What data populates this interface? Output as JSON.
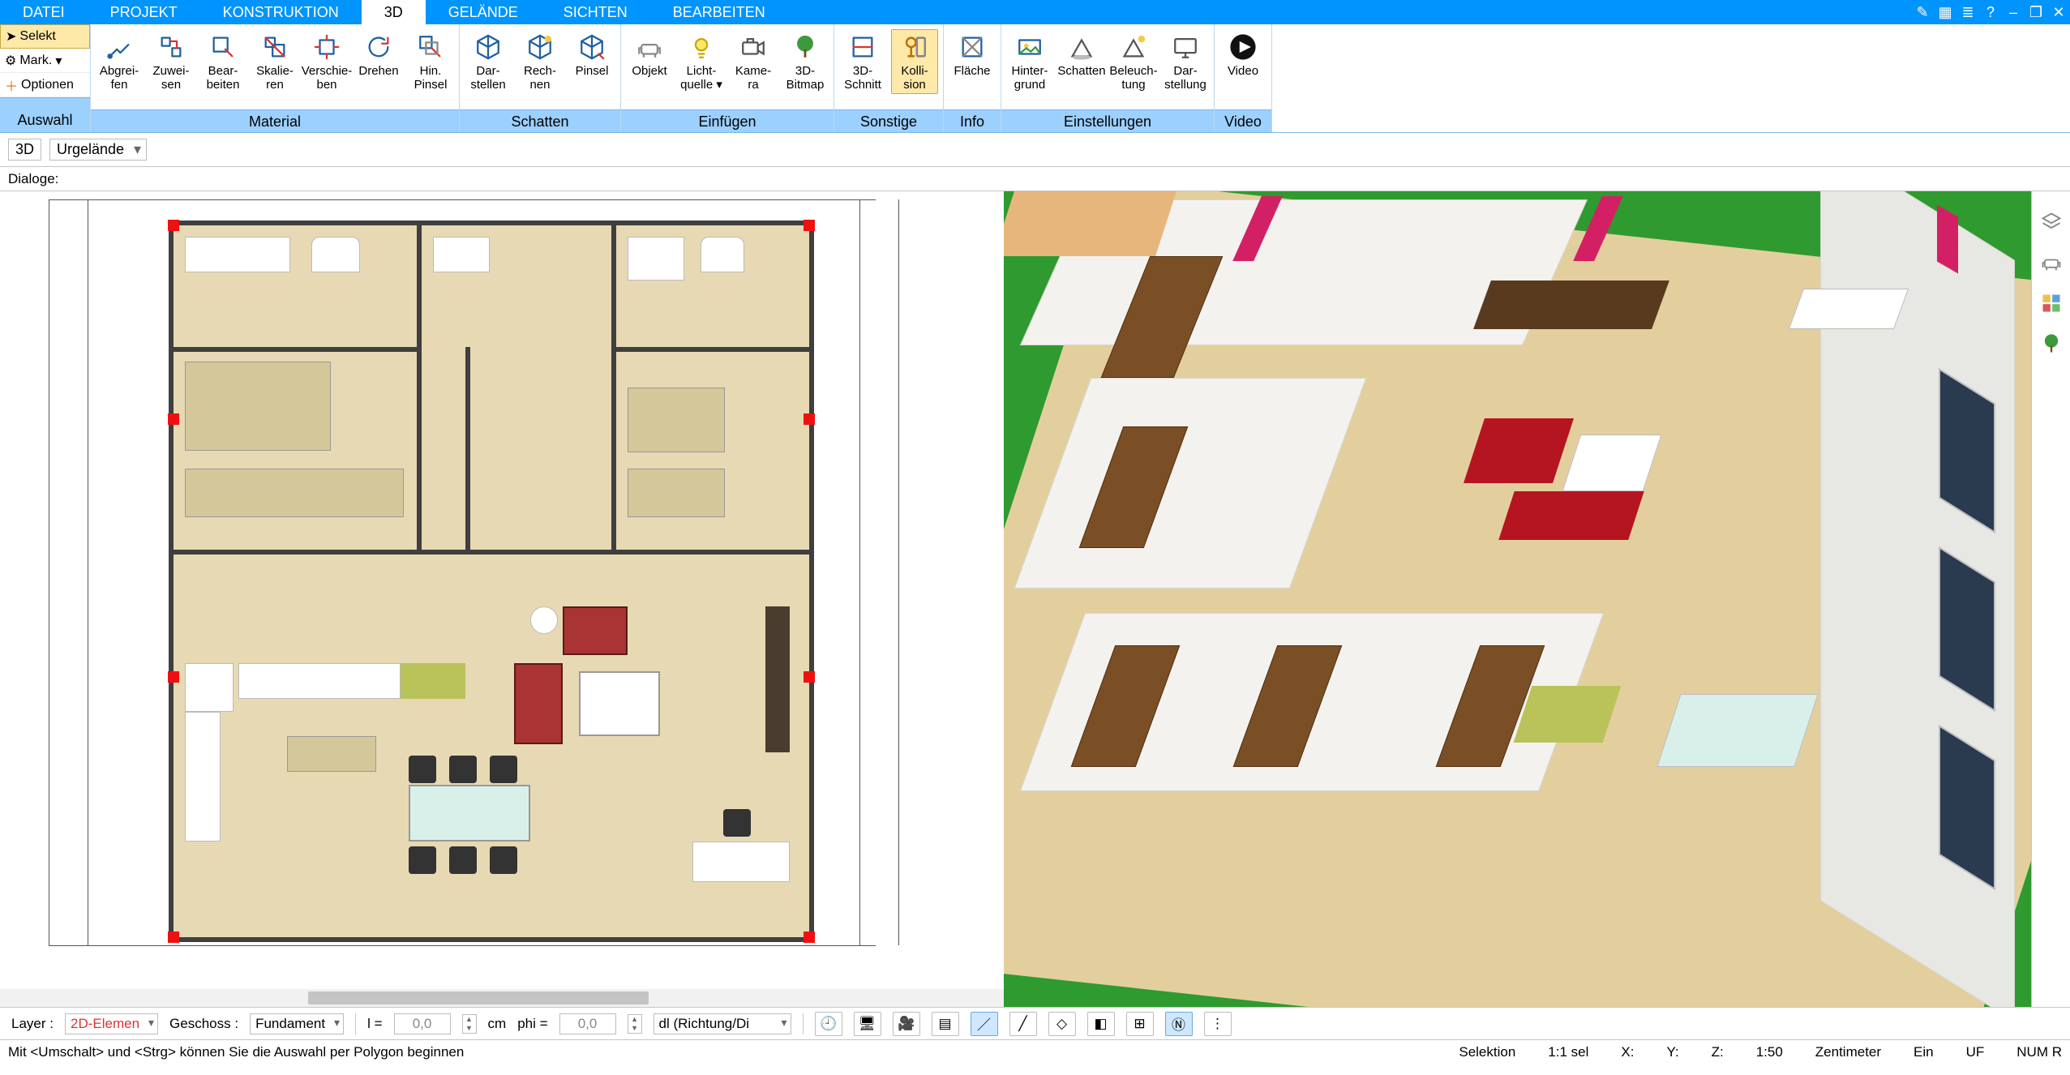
{
  "menubar": {
    "tabs": [
      "DATEI",
      "PROJEKT",
      "KONSTRUKTION",
      "3D",
      "GELÄNDE",
      "SICHTEN",
      "BEARBEITEN"
    ],
    "active_index": 3,
    "window_icons": [
      "tool",
      "box",
      "layers",
      "help",
      "min",
      "restore",
      "close"
    ]
  },
  "ribbon": {
    "left": {
      "selekt": "Selekt",
      "mark": "Mark.",
      "optionen": "Optionen",
      "group_label": "Auswahl"
    },
    "groups": [
      {
        "name": "Material",
        "buttons": [
          {
            "id": "abgreifen",
            "label": "Abgrei-\nfen"
          },
          {
            "id": "zuweisen",
            "label": "Zuwei-\nsen"
          },
          {
            "id": "bearbeiten",
            "label": "Bear-\nbeiten"
          },
          {
            "id": "skalieren",
            "label": "Skalie-\nren"
          },
          {
            "id": "verschieben",
            "label": "Verschie-\nben"
          },
          {
            "id": "drehen",
            "label": "Drehen"
          },
          {
            "id": "hinpinsel",
            "label": "Hin.\nPinsel"
          }
        ]
      },
      {
        "name": "Schatten",
        "buttons": [
          {
            "id": "darstellen",
            "label": "Dar-\nstellen"
          },
          {
            "id": "rechnen",
            "label": "Rech-\nnen"
          },
          {
            "id": "pinsel",
            "label": "Pinsel"
          }
        ]
      },
      {
        "name": "Einfügen",
        "buttons": [
          {
            "id": "objekt",
            "label": "Objekt"
          },
          {
            "id": "lichtquelle",
            "label": "Licht-\nquelle ▾"
          },
          {
            "id": "kamera",
            "label": "Kame-\nra"
          },
          {
            "id": "3dbitmap",
            "label": "3D-\nBitmap"
          }
        ]
      },
      {
        "name": "Sonstige",
        "buttons": [
          {
            "id": "3dschnitt",
            "label": "3D-\nSchnitt"
          },
          {
            "id": "kollision",
            "label": "Kolli-\nsion",
            "active": true
          }
        ]
      },
      {
        "name": "Info",
        "buttons": [
          {
            "id": "flaeche",
            "label": "Fläche"
          }
        ]
      },
      {
        "name": "Einstellungen",
        "buttons": [
          {
            "id": "hintergrund",
            "label": "Hinter-\ngrund"
          },
          {
            "id": "schatten2",
            "label": "Schatten"
          },
          {
            "id": "beleuchtung",
            "label": "Beleuch-\ntung"
          },
          {
            "id": "darstellung",
            "label": "Dar-\nstellung"
          }
        ]
      },
      {
        "name": "",
        "buttons": [
          {
            "id": "video",
            "label": "Video"
          }
        ]
      }
    ],
    "last_group_label": "Video"
  },
  "secbar": {
    "left_badge": "3D",
    "terrain_combo": "Urgelände"
  },
  "dlgbar": {
    "label": "Dialoge:"
  },
  "bottombar": {
    "layer_label": "Layer :",
    "layer_value": "2D-Elemen",
    "geschoss_label": "Geschoss :",
    "geschoss_value": "Fundament",
    "l_label": "l =",
    "l_value": "0,0",
    "unit_cm": "cm",
    "phi_label": "phi =",
    "phi_value": "0,0",
    "mode_combo": "dl (Richtung/Di",
    "tool_icons": [
      "clock",
      "monitor",
      "camera",
      "stack",
      "line-a",
      "line-b",
      "plane",
      "cube",
      "grid",
      "north",
      "more"
    ]
  },
  "statusbar": {
    "hint": "Mit <Umschalt> und <Strg> können Sie die Auswahl per Polygon beginnen",
    "selektion": "Selektion",
    "scale": "1:1 sel",
    "X": "X:",
    "Y": "Y:",
    "Z": "Z:",
    "ratio": "1:50",
    "unit": "Zentimeter",
    "ein": "Ein",
    "uf": "UF",
    "numr": "NUM R"
  },
  "palette_icons": [
    "layers",
    "chair",
    "swatch",
    "tree"
  ]
}
